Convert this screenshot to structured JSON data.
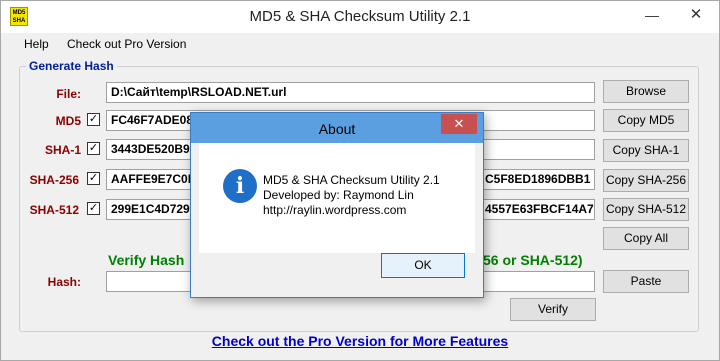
{
  "window": {
    "title": "MD5 & SHA Checksum Utility 2.1",
    "icon_text": "MD5 SHA",
    "minimize_glyph": "—",
    "close_glyph": "✕"
  },
  "menu": {
    "items": [
      {
        "label": "Help"
      },
      {
        "label": "Check out Pro Version"
      }
    ]
  },
  "generate": {
    "group_title": "Generate Hash",
    "file_label": "File:",
    "file_value": "D:\\Сайт\\temp\\RSLOAD.NET.url",
    "browse_label": "Browse",
    "check_glyph": "✓",
    "rows": [
      {
        "label": "MD5",
        "value_left": "FC46F7ADE08",
        "value_right": "",
        "button": "Copy MD5"
      },
      {
        "label": "SHA-1",
        "value_left": "3443DE520B9",
        "value_right": "",
        "button": "Copy SHA-1"
      },
      {
        "label": "SHA-256",
        "value_left": "AAFFE9E7C0D",
        "value_right": "C5F8ED1896DBB1",
        "button": "Copy SHA-256"
      },
      {
        "label": "SHA-512",
        "value_left": "299E1C4D729",
        "value_right": "4557E63FBCF14A7",
        "button": "Copy SHA-512"
      }
    ],
    "copy_all_label": "Copy All"
  },
  "verify": {
    "title": "Verify Hash",
    "title_tail": "56 or SHA-512)",
    "hash_label": "Hash:",
    "hash_value": "",
    "paste_label": "Paste",
    "verify_label": "Verify"
  },
  "pro_link": "Check out the Pro Version for More Features",
  "dialog": {
    "title": "About",
    "close_glyph": "✕",
    "icon_glyph": "i",
    "lines": [
      "MD5 & SHA Checksum Utility 2.1",
      "Developed by: Raymond Lin",
      "http://raylin.wordpress.com"
    ],
    "ok_label": "OK"
  },
  "colors": {
    "label_red": "#8b0000",
    "group_blue": "#0020a0",
    "verify_green": "#008000",
    "link_blue": "#0000cc",
    "dialog_title_blue": "#5c9fe0"
  }
}
